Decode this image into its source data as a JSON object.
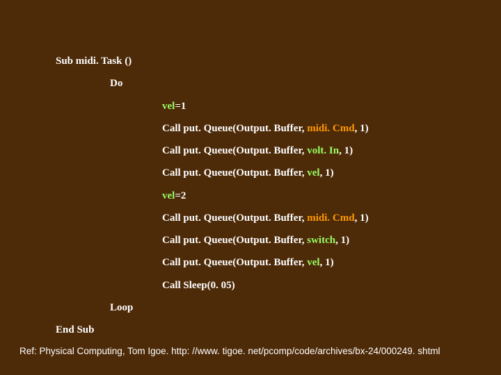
{
  "code": {
    "l1": "Sub midi. Task ()",
    "l2": "Do",
    "l3a": "vel",
    "l3b": "=1",
    "l4a": "Call put. Queue(Output. Buffer, ",
    "l4b": "midi. Cmd",
    "l4c": ", 1)",
    "l5a": "Call put. Queue(Output. Buffer, ",
    "l5b": "volt. In",
    "l5c": ", 1)",
    "l6a": "Call put. Queue(Output. Buffer, ",
    "l6b": "vel",
    "l6c": ", 1)",
    "l7a": "vel",
    "l7b": "=2",
    "l8a": "Call put. Queue(Output. Buffer, ",
    "l8b": "midi. Cmd",
    "l8c": ", 1)",
    "l9a": "Call put. Queue(Output. Buffer, ",
    "l9b": "switch",
    "l9c": ", 1)",
    "l10a": "Call put. Queue(Output. Buffer, ",
    "l10b": "vel",
    "l10c": ", 1)",
    "l11": "Call Sleep(0. 05)",
    "l12": "Loop",
    "l13": "End Sub"
  },
  "footer": "Ref: Physical Computing, Tom Igoe. http: //www. tigoe. net/pcomp/code/archives/bx-24/000249. shtml"
}
